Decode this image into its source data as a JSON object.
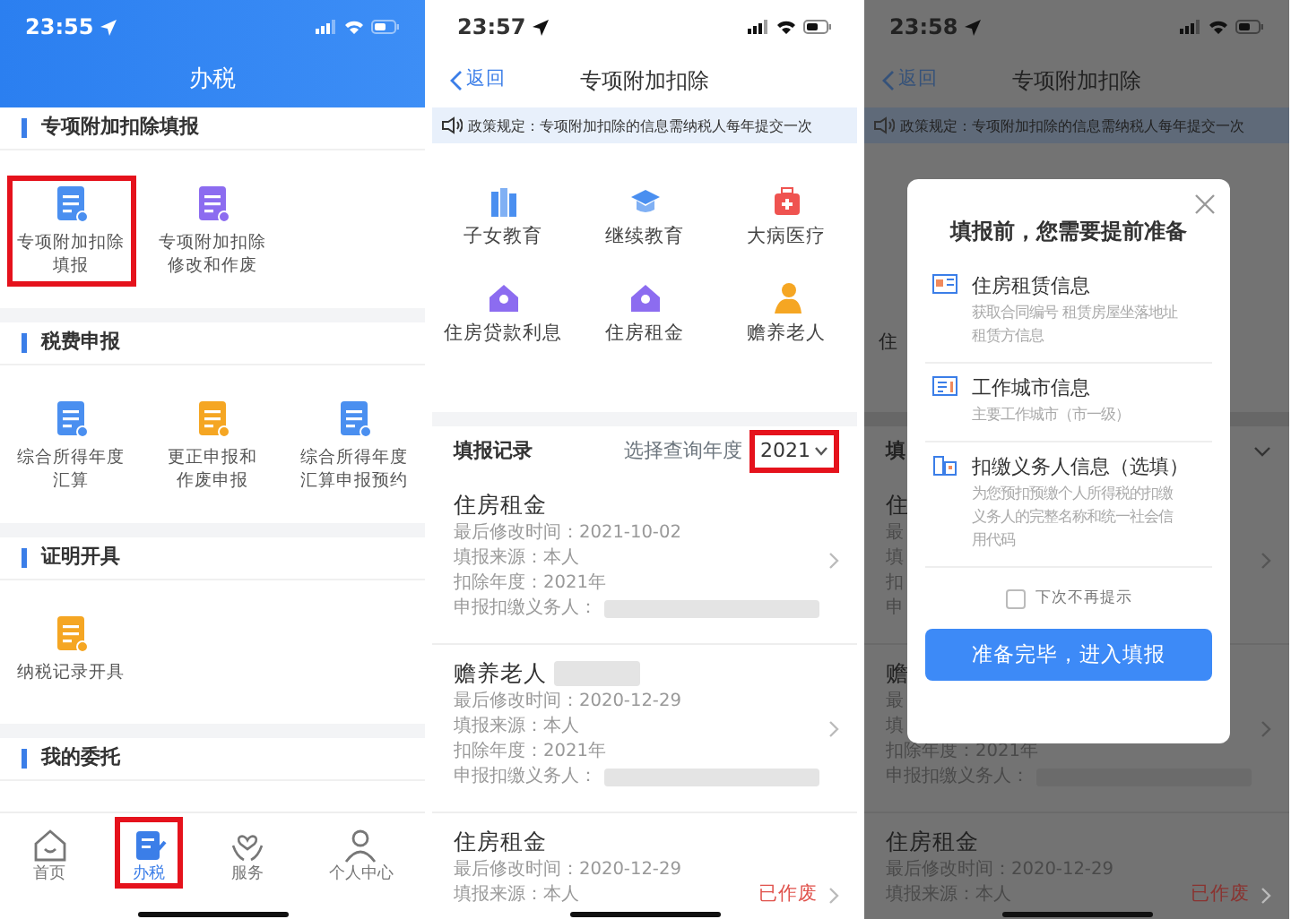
{
  "screens": [
    {
      "kind": "home",
      "status_time": "23:55",
      "title": "办税",
      "sections": [
        {
          "title": "专项附加扣除填报",
          "items": [
            {
              "lines": [
                "专项附加扣除",
                "填报"
              ],
              "color": "#4a8ff0",
              "highlighted": true
            },
            {
              "lines": [
                "专项附加扣除",
                "修改和作废"
              ],
              "color": "#8c6cf0",
              "highlighted": false
            }
          ]
        },
        {
          "title": "税费申报",
          "items": [
            {
              "lines": [
                "综合所得年度",
                "汇算"
              ],
              "color": "#4a8ff0",
              "highlighted": false
            },
            {
              "lines": [
                "更正申报和",
                "作废申报"
              ],
              "color": "#f5a623",
              "highlighted": false
            },
            {
              "lines": [
                "综合所得年度",
                "汇算申报预约"
              ],
              "color": "#4a8ff0",
              "highlighted": false
            }
          ]
        },
        {
          "title": "证明开具",
          "items": [
            {
              "lines": [
                "纳税记录开具"
              ],
              "color": "#f5a623",
              "highlighted": false
            }
          ]
        },
        {
          "title": "我的委托"
        }
      ],
      "tabbar": [
        {
          "label": "首页",
          "selected": false,
          "highlighted": false
        },
        {
          "label": "办税",
          "selected": true,
          "highlighted": true
        },
        {
          "label": "服务",
          "selected": false,
          "highlighted": false
        },
        {
          "label": "个人中心",
          "selected": false,
          "highlighted": false
        }
      ]
    },
    {
      "kind": "list",
      "status_time": "23:57",
      "back": "返回",
      "title": "专项附加扣除",
      "banner": "政策规定：专项附加扣除的信息需纳税人每年提交一次",
      "categories": [
        {
          "label": "子女教育",
          "color": "#4a8ff0"
        },
        {
          "label": "继续教育",
          "color": "#4a8ff0"
        },
        {
          "label": "大病医疗",
          "color": "#ef5350"
        },
        {
          "label": "住房贷款利息",
          "color": "#8c6cf0"
        },
        {
          "label": "住房租金",
          "color": "#8c6cf0"
        },
        {
          "label": "赡养老人",
          "color": "#f5a623"
        }
      ],
      "records_header": {
        "title": "填报记录",
        "hint": "选择查询年度",
        "year": "2021",
        "highlighted": true
      },
      "records": [
        {
          "title": "住房租金",
          "lines": [
            {
              "text": "最后修改时间：2021-10-02"
            },
            {
              "text": "填报来源：本人"
            },
            {
              "text": "扣除年度：2021年"
            },
            {
              "text": "申报扣缴义务人：",
              "redacted": true
            }
          ]
        },
        {
          "title": "赡养老人",
          "title_redacted": true,
          "lines": [
            {
              "text": "最后修改时间：2020-12-29"
            },
            {
              "text": "填报来源：本人"
            },
            {
              "text": "扣除年度：2021年"
            },
            {
              "text": "申报扣缴义务人：",
              "redacted": true
            }
          ]
        },
        {
          "title": "住房租金",
          "status": "已作废",
          "lines": [
            {
              "text": "最后修改时间：2020-12-29"
            },
            {
              "text": "填报来源：本人"
            }
          ]
        }
      ]
    },
    {
      "kind": "list",
      "status_time": "23:58",
      "back": "返回",
      "title": "专项附加扣除",
      "banner": "政策规定：专项附加扣除的信息需纳税人每年提交一次",
      "category_fragment": "住",
      "records_header": {
        "title": "填"
      },
      "records": [
        {
          "title": "住",
          "lines": [
            {
              "text": "最"
            },
            {
              "text": "填"
            },
            {
              "text": "扣"
            },
            {
              "text": "申"
            }
          ]
        },
        {
          "title": "赡",
          "lines": [
            {
              "text": "最"
            },
            {
              "text": "填"
            },
            {
              "text": "扣除年度：2021年"
            },
            {
              "text": "申报扣缴义务人：",
              "redacted": true
            }
          ]
        },
        {
          "title": "住房租金",
          "status": "已作废",
          "lines": [
            {
              "text": "最后修改时间：2020-12-29"
            },
            {
              "text": "填报来源：本人"
            }
          ]
        }
      ],
      "modal": {
        "title": "填报前，您需要提前准备",
        "items": [
          {
            "title": "住房租赁信息",
            "desc": [
              "获取合同编号 租赁房屋坐落地址",
              "租赁方信息"
            ]
          },
          {
            "title": "工作城市信息",
            "desc": [
              "主要工作城市（市一级）"
            ]
          },
          {
            "title": "扣缴义务人信息（选填）",
            "desc": [
              "为您预扣预缴个人所得税的扣缴",
              "义务人的完整名称和统一社会信",
              "用代码"
            ]
          }
        ],
        "checkbox": {
          "label": "下次不再提示",
          "checked": false
        },
        "button": "准备完毕，进入填报"
      }
    }
  ]
}
